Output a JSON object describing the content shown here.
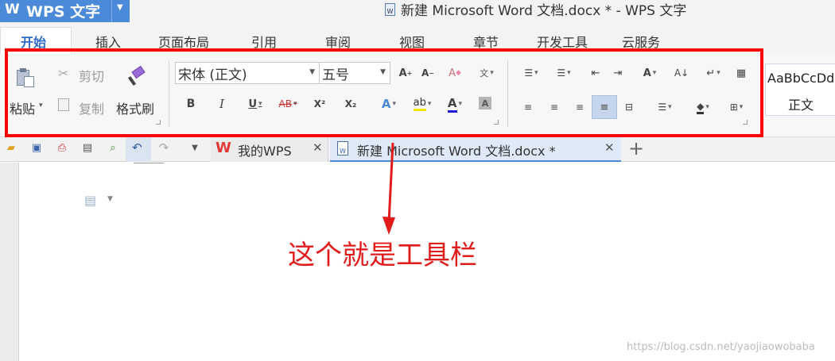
{
  "app": {
    "name": "WPS 文字",
    "logo_glyph": "W",
    "window_title": "新建 Microsoft Word 文档.docx * - WPS 文字"
  },
  "menu_tabs": [
    "开始",
    "插入",
    "页面布局",
    "引用",
    "审阅",
    "视图",
    "章节",
    "开发工具",
    "云服务"
  ],
  "toolbar": {
    "paste": "粘贴",
    "cut": "剪切",
    "copy": "复制",
    "format_painter": "格式刷",
    "font_name": "宋体 (正文)",
    "font_size": "五号",
    "bold": "B",
    "italic": "I",
    "underline": "U",
    "strike": "AB",
    "superscript": "X²",
    "subscript": "X₂",
    "style_preview": "AaBbCcDd",
    "style_name": "正文"
  },
  "doc_tabs": [
    {
      "label": "我的WPS",
      "active": false
    },
    {
      "label": "新建 Microsoft Word 文档.docx *",
      "active": true
    }
  ],
  "annotation": {
    "text": "这个就是工具栏"
  },
  "watermark": "https://blog.csdn.net/yaojiaowobaba",
  "colors": {
    "title_blue": "#4a8ad8",
    "highlight_red": "#ff0000",
    "annotation_red": "#e21b1b"
  }
}
